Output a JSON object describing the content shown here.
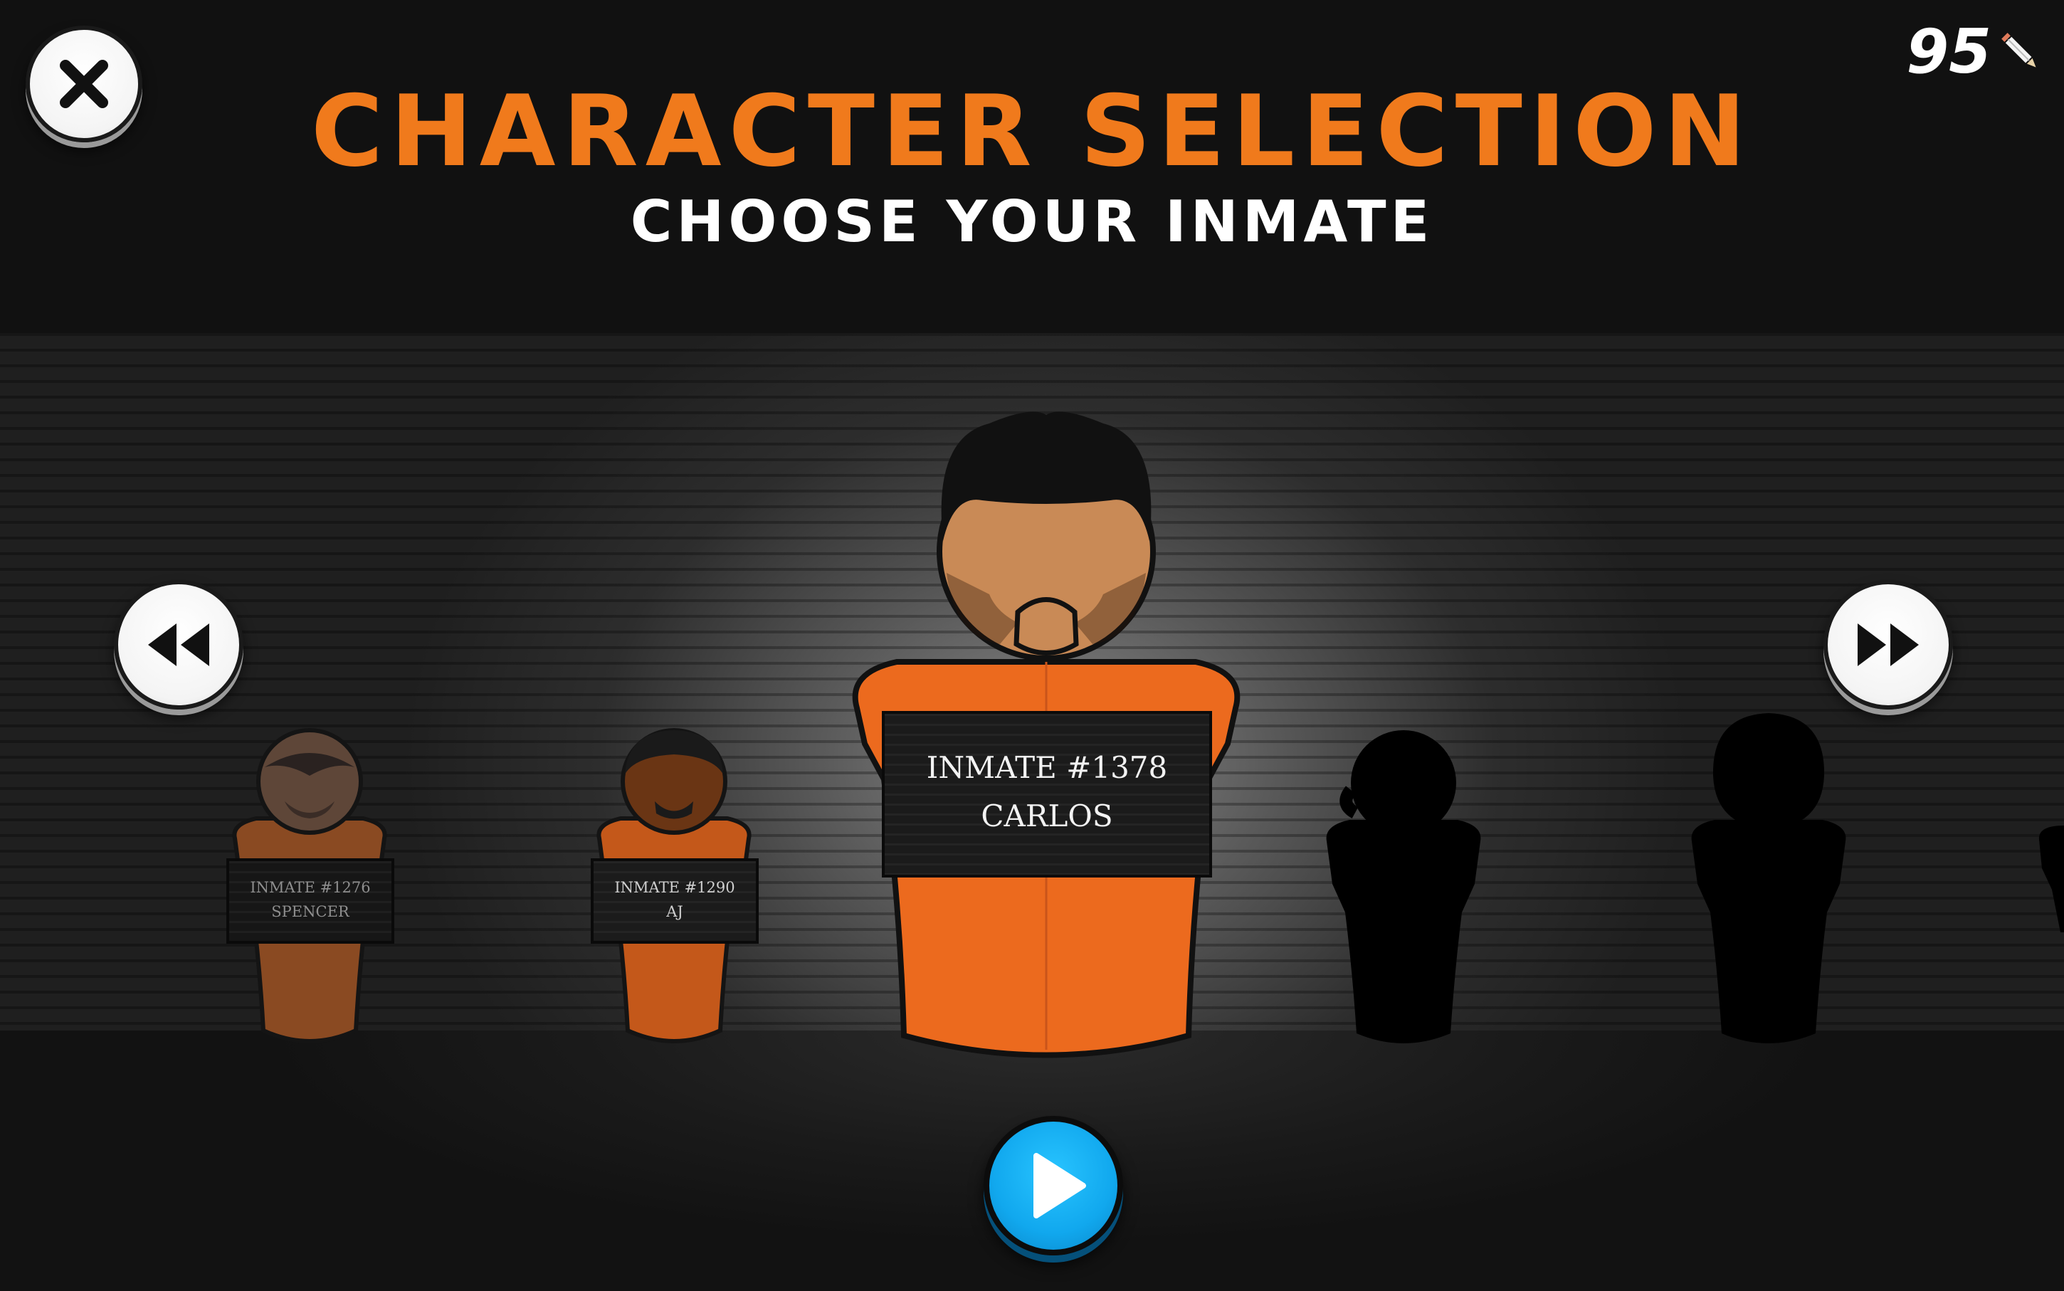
{
  "header": {
    "title": "CHARACTER SELECTION",
    "subtitle": "CHOOSE YOUR INMATE"
  },
  "currency": {
    "value": "95",
    "icon": "pencil-icon"
  },
  "controls": {
    "close_icon": "close-icon",
    "prev_icon": "rewind-icon",
    "next_icon": "fast-forward-icon",
    "play_icon": "play-icon"
  },
  "characters": [
    {
      "inmate_label": "INMATE #1276",
      "name": "SPENCER",
      "state": "unlocked",
      "selected": false
    },
    {
      "inmate_label": "INMATE #1290",
      "name": "AJ",
      "state": "unlocked",
      "selected": false
    },
    {
      "inmate_label": "INMATE #1378",
      "name": "CARLOS",
      "state": "unlocked",
      "selected": true
    },
    {
      "inmate_label": "",
      "name": "",
      "state": "locked",
      "selected": false
    },
    {
      "inmate_label": "",
      "name": "",
      "state": "locked",
      "selected": false
    }
  ],
  "colors": {
    "title": "#f07a1c",
    "jumpsuit": "#ec6a1e",
    "play_button": "#11a8ee",
    "background": "#111111"
  }
}
